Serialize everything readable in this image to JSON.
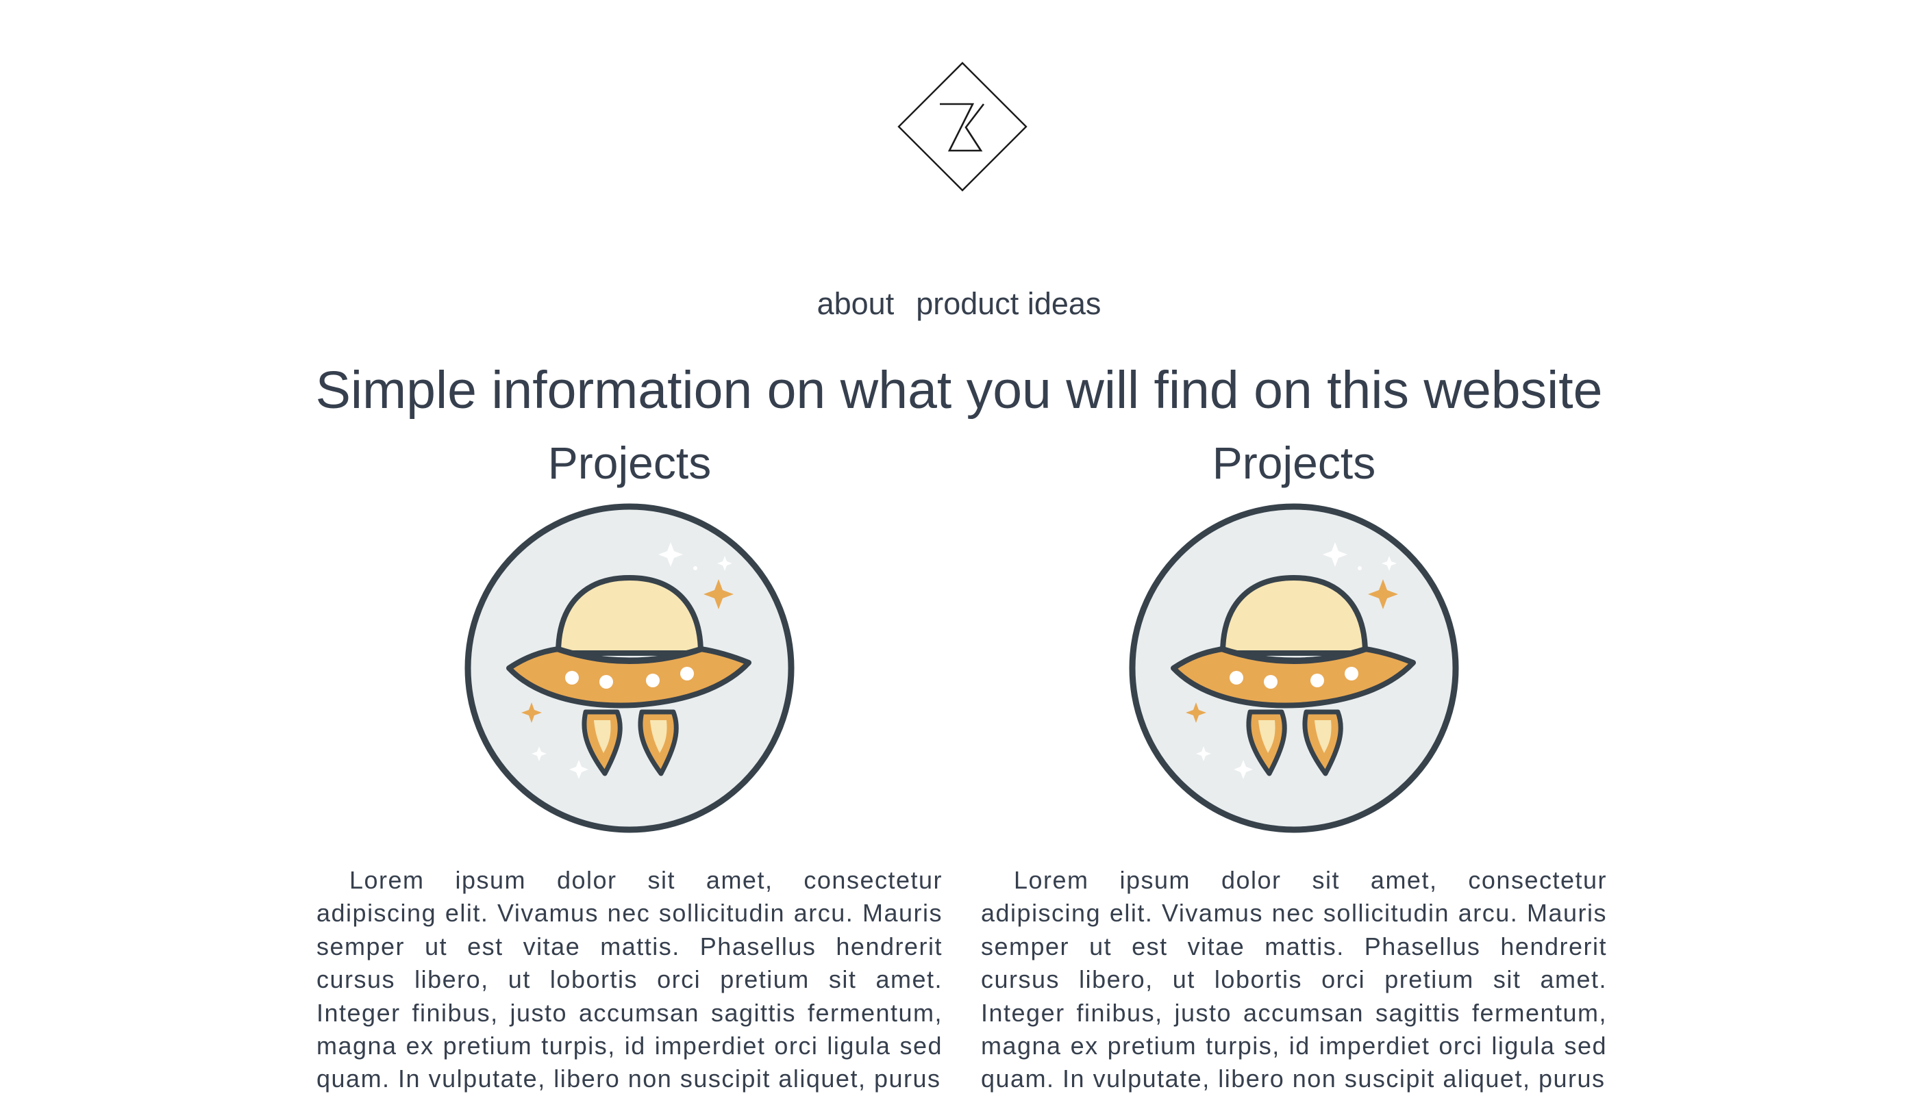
{
  "header": {
    "logo_icon": "kb-diamond-logo-icon"
  },
  "nav": {
    "items": [
      {
        "label": "about"
      },
      {
        "label": "product ideas"
      }
    ]
  },
  "main": {
    "headline": "Simple information on what you will find on this website",
    "cards": [
      {
        "title": "Projects",
        "icon": "ufo-spaceship-icon",
        "text": "Lorem ipsum dolor sit amet, consectetur adipiscing elit. Vivamus nec sollicitudin arcu. Mauris semper ut est vitae mattis. Phasellus hendrerit cursus libero, ut lobortis orci pretium sit amet. Integer finibus, justo accumsan sagittis fermentum, magna ex pretium turpis, id imperdiet orci ligula sed quam. In vulputate, libero non suscipit aliquet, purus"
      },
      {
        "title": "Projects",
        "icon": "ufo-spaceship-icon",
        "text": "Lorem ipsum dolor sit amet, consectetur adipiscing elit. Vivamus nec sollicitudin arcu. Mauris semper ut est vitae mattis. Phasellus hendrerit cursus libero, ut lobortis orci pretium sit amet. Integer finibus, justo accumsan sagittis fermentum, magna ex pretium turpis, id imperdiet orci ligula sed quam. In vulputate, libero non suscipit aliquet, purus"
      }
    ]
  },
  "colors": {
    "text": "#363f4d",
    "circle_fill": "#e9edee",
    "saucer_orange": "#e8a953",
    "dome_cream": "#f8e6b4",
    "outline": "#37424b"
  }
}
